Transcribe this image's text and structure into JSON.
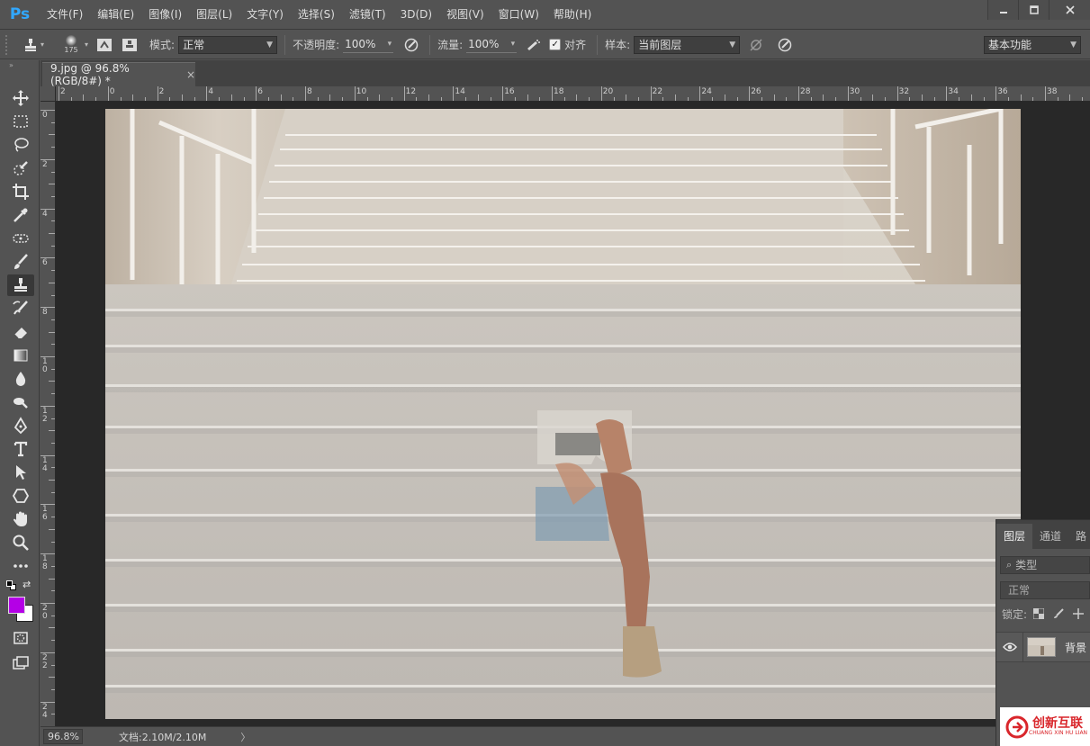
{
  "app": {
    "logo": "Ps",
    "menu": [
      "文件(F)",
      "编辑(E)",
      "图像(I)",
      "图层(L)",
      "文字(Y)",
      "选择(S)",
      "滤镜(T)",
      "3D(D)",
      "视图(V)",
      "窗口(W)",
      "帮助(H)"
    ],
    "window_controls": [
      "minimize",
      "maximize",
      "close"
    ]
  },
  "options": {
    "brush_size": "175",
    "mode_label": "模式:",
    "mode_value": "正常",
    "opacity_label": "不透明度:",
    "opacity_value": "100%",
    "flow_label": "流量:",
    "flow_value": "100%",
    "aligned_label": "对齐",
    "aligned_checked": true,
    "sample_label": "样本:",
    "sample_value": "当前图层",
    "workspace": "基本功能"
  },
  "document": {
    "tab_title": "9.jpg @ 96.8%(RGB/8#) *",
    "close_glyph": "×",
    "zoom": "96.8%",
    "doc_info": "文档:2.10M/2.10M",
    "status_arrow": "〉"
  },
  "rulers": {
    "horizontal": [
      "2",
      "0",
      "2",
      "4",
      "6",
      "8",
      "10",
      "12",
      "14",
      "16",
      "18",
      "20",
      "22",
      "24",
      "26",
      "28",
      "30",
      "32",
      "34",
      "36",
      "38"
    ],
    "vertical": [
      "0",
      "2",
      "4",
      "6",
      "8",
      "10",
      "12",
      "14",
      "16",
      "18",
      "20",
      "22",
      "24"
    ]
  },
  "tools": [
    "move-tool",
    "marquee-tool",
    "lasso-tool",
    "quick-select-tool",
    "crop-tool",
    "eyedropper-tool",
    "healing-brush-tool",
    "brush-tool",
    "clone-stamp-tool",
    "history-brush-tool",
    "eraser-tool",
    "gradient-tool",
    "blur-tool",
    "dodge-tool",
    "pen-tool",
    "type-tool",
    "path-selection-tool",
    "shape-tool",
    "hand-tool",
    "zoom-tool",
    "more-tools"
  ],
  "active_tool": "clone-stamp-tool",
  "colors": {
    "foreground": "#b400e6",
    "background": "#ffffff",
    "accent": "#31a8ff"
  },
  "layers_panel": {
    "tabs": [
      "图层",
      "通道",
      "路"
    ],
    "filter_placeholder": "类型",
    "blend_mode": "正常",
    "lock_label": "锁定:",
    "layer_name": "背景"
  },
  "watermark": {
    "text": "创新互联",
    "sub": "CHUANG XIN HU LIAN"
  }
}
